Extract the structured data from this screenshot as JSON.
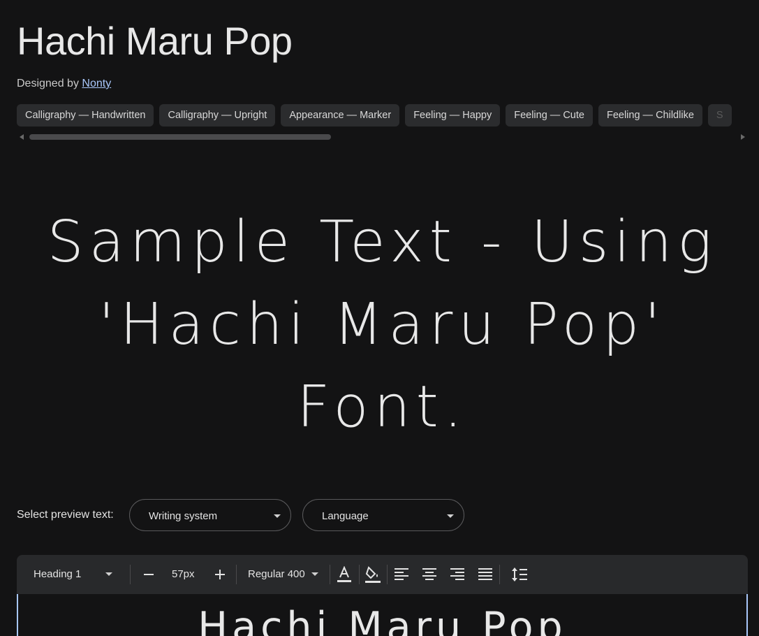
{
  "font": {
    "title": "Hachi Maru Pop",
    "designed_by_label": "Designed by",
    "designer": "Nonty"
  },
  "tags": [
    "Calligraphy — Handwritten",
    "Calligraphy — Upright",
    "Appearance — Marker",
    "Feeling — Happy",
    "Feeling — Cute",
    "Feeling — Childlike",
    "S"
  ],
  "sample": {
    "line1": "Sample Text - Using",
    "line2": "'Hachi Maru Pop'",
    "line3": "Font."
  },
  "preview": {
    "label": "Select preview text:",
    "writing_system": "Writing system",
    "language": "Language"
  },
  "toolbar": {
    "style": "Heading 1",
    "size": "57px",
    "weight": "Regular 400",
    "icons": [
      "minus-icon",
      "plus-icon",
      "text-color-icon",
      "highlight-color-icon",
      "align-left-icon",
      "align-center-icon",
      "align-right-icon",
      "align-justify-icon",
      "line-height-icon"
    ]
  },
  "editor": {
    "text": "Hachi Maru Pop"
  },
  "colors": {
    "background": "#131314",
    "chip": "#2b2c2e",
    "link": "#a8c7fa",
    "toolbar": "#28292b"
  }
}
